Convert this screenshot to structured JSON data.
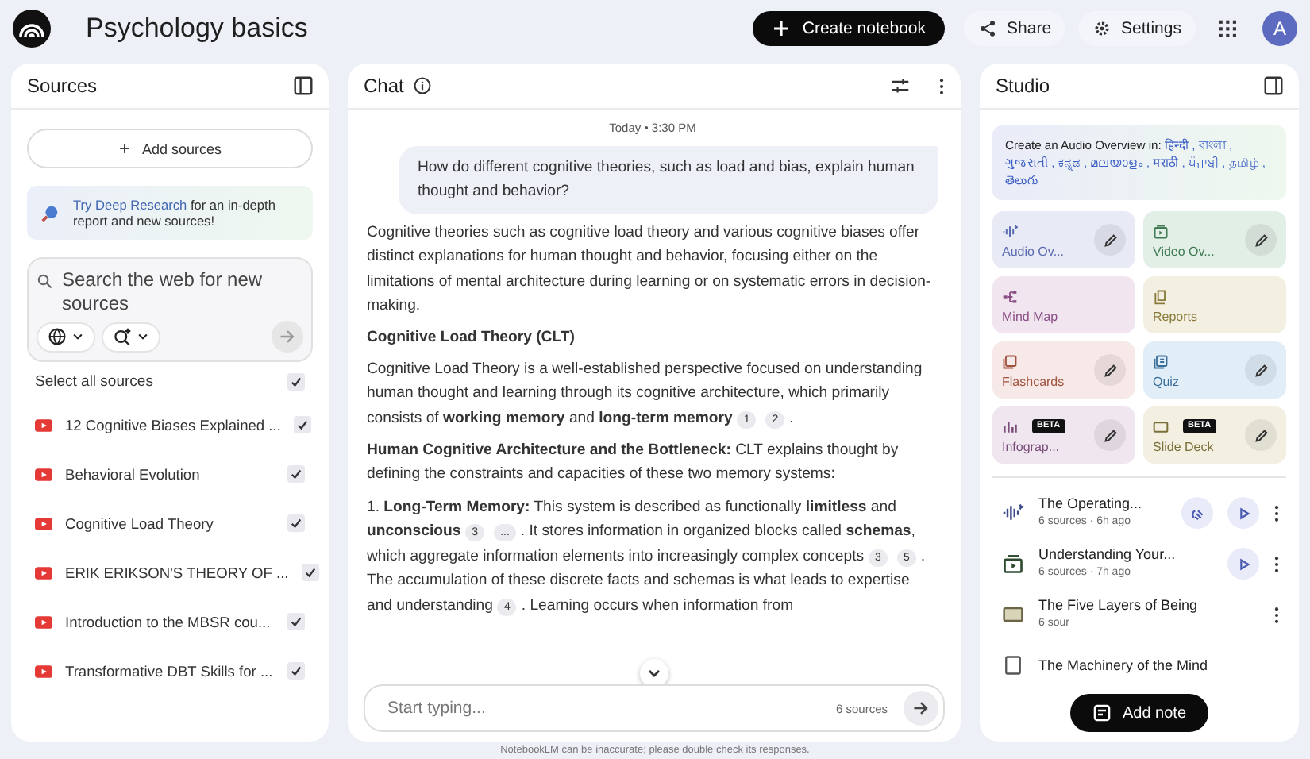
{
  "app": {
    "title": "Psychology basics",
    "avatar": "A"
  },
  "header_actions": [
    {
      "kind": "primary",
      "label": "Create notebook"
    },
    {
      "kind": "share",
      "label": "Share"
    },
    {
      "kind": "settings",
      "label": "Settings"
    }
  ],
  "sources": {
    "title": "Sources",
    "add_button": "Add sources",
    "promo": {
      "link": "Try Deep Research",
      "text": " for an in-depth report and new sources!"
    },
    "search": {
      "placeholder": "Search the web for new sources"
    },
    "select_all": {
      "label": "Select all sources",
      "checked": true
    },
    "items": [
      {
        "title": "12 Cognitive Biases Explained ...",
        "checked": true
      },
      {
        "title": "Behavioral Evolution",
        "checked": true
      },
      {
        "title": "Cognitive Load Theory",
        "checked": true
      },
      {
        "title": "ERIK ERIKSON'S THEORY OF ...",
        "checked": true
      },
      {
        "title": "Introduction to the MBSR cou...",
        "checked": true
      },
      {
        "title": "Transformative DBT Skills for ...",
        "checked": true
      }
    ]
  },
  "chat": {
    "title": "Chat",
    "timestamp": "Today • 3:30 PM",
    "question": "How do different cognitive theories, such as load and bias, explain human thought and behavior?",
    "answer": [
      {
        "kind": "para",
        "parts": [
          {
            "kind": "text",
            "text": "Cognitive theories such as cognitive load theory and various cognitive biases offer distinct explanations for human thought and behavior, focusing either on the limitations of mental architecture during learning or on systematic errors in decision-making."
          }
        ]
      },
      {
        "kind": "heading",
        "text": "Cognitive Load Theory (CLT)"
      },
      {
        "kind": "para",
        "parts": [
          {
            "kind": "text",
            "text": "Cognitive Load Theory is a well-established perspective focused on understanding human thought and learning through its cognitive architecture, which primarily consists of **working memory** and **long-term memory**"
          },
          {
            "kind": "cite",
            "text": "1"
          },
          {
            "kind": "cite",
            "text": "2"
          },
          {
            "kind": "text",
            "text": "."
          }
        ]
      },
      {
        "kind": "para",
        "parts": [
          {
            "kind": "text",
            "text": "**Human Cognitive Architecture and the Bottleneck:** CLT explains thought by defining the constraints and capacities of these two memory systems:"
          }
        ]
      },
      {
        "kind": "para",
        "parts": [
          {
            "kind": "text",
            "text": "1. **Long-Term Memory:** This system is described as functionally **limitless** and **unconscious**"
          },
          {
            "kind": "cite",
            "text": "3"
          },
          {
            "kind": "cite",
            "text": "..."
          },
          {
            "kind": "text",
            "text": ". It stores information in organized blocks called **schemas**, which aggregate information elements into increasingly complex concepts"
          },
          {
            "kind": "cite",
            "text": "3"
          },
          {
            "kind": "cite",
            "text": "5"
          },
          {
            "kind": "text",
            "text": ". The accumulation of these discrete facts and schemas is what leads to expertise and understanding"
          },
          {
            "kind": "cite",
            "text": "4"
          },
          {
            "kind": "text",
            "text": ". Learning occurs when information from"
          }
        ]
      }
    ],
    "input": {
      "placeholder": "Start typing...",
      "source_count": "6 sources"
    }
  },
  "studio": {
    "title": "Studio",
    "languages_prompt": "Create an Audio Overview in:",
    "languages": [
      "हिन्दी ,",
      "বাংলা ,",
      "ગુજરાતી ,",
      "ಕನ್ನಡ ,",
      "മലയാളം ,",
      "मराठी ,",
      "ਪੰਜਾਬੀ ,",
      "தமிழ் ,",
      "తెలుగు"
    ],
    "tools": [
      {
        "kind": "audio",
        "label": "Audio Ov...",
        "color": "#e8eaf6",
        "editable": true
      },
      {
        "kind": "video",
        "label": "Video Ov...",
        "color": "#e2efe6",
        "editable": true
      },
      {
        "kind": "mindmap",
        "label": "Mind Map",
        "color": "#f1e6f0",
        "editable": false
      },
      {
        "kind": "report",
        "label": "Reports",
        "color": "#f3f0e2",
        "editable": false
      },
      {
        "kind": "flashcards",
        "label": "Flashcards",
        "color": "#f7e9e7",
        "editable": true
      },
      {
        "kind": "quiz",
        "label": "Quiz",
        "color": "#e1eef8",
        "editable": true
      },
      {
        "kind": "infographic",
        "label": "Infograp...",
        "color": "#efe6f0",
        "badge": "BETA",
        "editable": true
      },
      {
        "kind": "slides",
        "label": "Slide Deck",
        "color": "#f3f0e2",
        "badge": "BETA",
        "editable": true
      }
    ],
    "artifacts": [
      {
        "kind": "audio",
        "title": "The Operating...",
        "meta": "6 sources · 6h ago",
        "interactive": true,
        "playable": true
      },
      {
        "kind": "video",
        "title": "Understanding Your...",
        "meta": "6 sources · 7h ago",
        "interactive": false,
        "playable": true
      },
      {
        "kind": "slides",
        "title": "The Five Layers of Being",
        "meta": "6 sour",
        "interactive": false,
        "playable": false
      },
      {
        "kind": "text",
        "title": "The Machinery of the Mind",
        "interactive": false,
        "playable": false
      }
    ],
    "add_note": "Add note"
  },
  "footer": "NotebookLM can be inaccurate; please double check its responses."
}
